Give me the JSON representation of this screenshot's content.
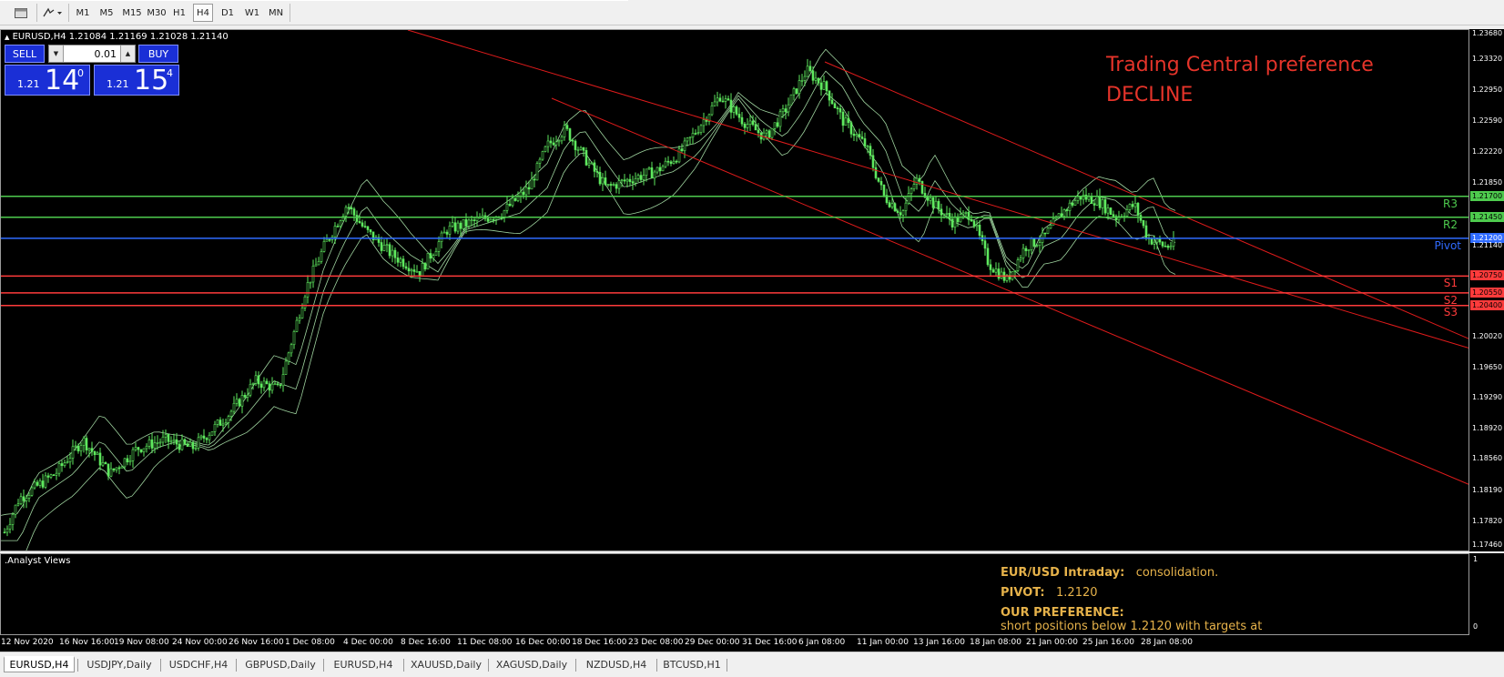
{
  "toolbar": {
    "timeframes": [
      "M1",
      "M5",
      "M15",
      "M30",
      "H1",
      "H4",
      "D1",
      "W1",
      "MN"
    ],
    "active_timeframe": "H4"
  },
  "chart": {
    "symbol_label": "EURUSD,H4  1.21084 1.21169 1.21028 1.21140",
    "annotation_line1": "Trading Central preference",
    "annotation_line2": "DECLINE",
    "annotation_color": "#e5342a"
  },
  "one_click": {
    "sell_label": "SELL",
    "buy_label": "BUY",
    "lot": "0.01",
    "sell_price_small": "1.21",
    "sell_price_big": "14",
    "sell_price_sup": "0",
    "buy_price_small": "1.21",
    "buy_price_big": "15",
    "buy_price_sup": "4"
  },
  "levels": [
    {
      "label": "R3",
      "price": 1.217,
      "tag": "1.21700",
      "color": "#4ecb4e"
    },
    {
      "label": "R2",
      "price": 1.2145,
      "tag": "1.21450",
      "color": "#4ecb4e"
    },
    {
      "label": "Pivot",
      "price": 1.212,
      "tag": "1.21200",
      "color": "#2f6bff"
    },
    {
      "label": "S1",
      "price": 1.2075,
      "tag": "1.20750",
      "color": "#ff3b3b"
    },
    {
      "label": "S2",
      "price": 1.2055,
      "tag": "1.20550",
      "color": "#ff3b3b"
    },
    {
      "label": "S3",
      "price": 1.204,
      "tag": "1.20400",
      "color": "#ff3b3b"
    }
  ],
  "current_price_tag": "1.21140",
  "price_axis_labels": [
    "1.23680",
    "1.23320",
    "1.22950",
    "1.22590",
    "1.22220",
    "1.21850",
    "1.21140",
    "1.20020",
    "1.19650",
    "1.19290",
    "1.18920",
    "1.18560",
    "1.18190",
    "1.17820",
    "1.17460"
  ],
  "time_axis_labels": [
    "12 Nov 2020",
    "16 Nov 16:00",
    "19 Nov 08:00",
    "24 Nov 00:00",
    "26 Nov 16:00",
    "1 Dec 08:00",
    "4 Dec 00:00",
    "8 Dec 16:00",
    "11 Dec 08:00",
    "16 Dec 00:00",
    "18 Dec 16:00",
    "23 Dec 08:00",
    "29 Dec 00:00",
    "31 Dec 16:00",
    "6 Jan 08:00",
    "11 Jan 00:00",
    "13 Jan 16:00",
    "18 Jan 08:00",
    "21 Jan 00:00",
    "25 Jan 16:00",
    "28 Jan 08:00"
  ],
  "subwindow": {
    "title": ".Analyst Views",
    "axis_top": "1",
    "axis_bottom": "0",
    "intraday_label": "EUR/USD Intraday:",
    "intraday_value": "consolidation.",
    "pivot_label": "PIVOT:",
    "pivot_value": "1.2120",
    "preference_label": "OUR PREFERENCE:",
    "preference_text": "short positions below 1.2120 with targets at"
  },
  "tabs": [
    "EURUSD,H4",
    "USDJPY,Daily",
    "USDCHF,H4",
    "GBPUSD,Daily",
    "EURUSD,H4",
    "XAUUSD,Daily",
    "XAGUSD,Daily",
    "NZDUSD,H4",
    "BTCUSD,H1"
  ],
  "active_tab": 0,
  "colors": {
    "candle": "#5ee85e",
    "bands": "#9fd49f",
    "channel": "#e01b1b"
  }
}
